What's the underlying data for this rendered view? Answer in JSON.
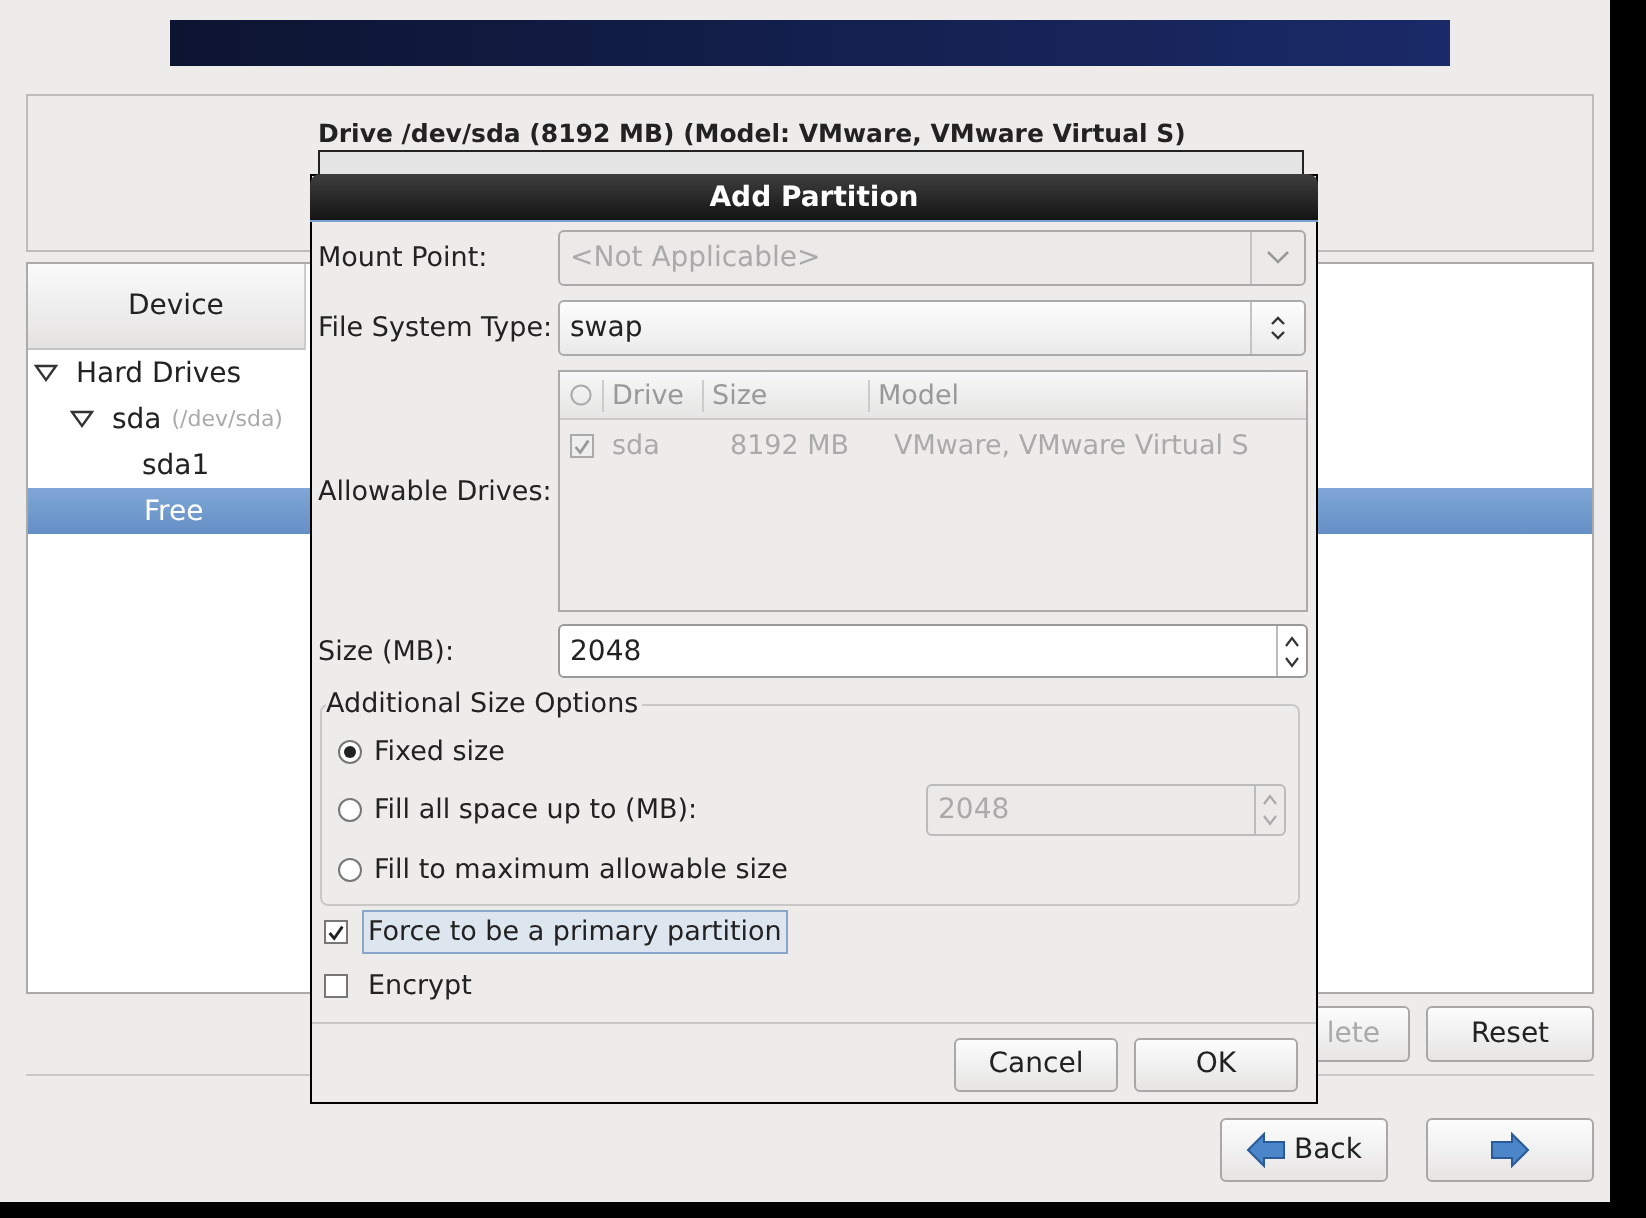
{
  "drive": {
    "title": "Drive /dev/sda (8192 MB) (Model: VMware, VMware Virtual S)"
  },
  "device_tree": {
    "column": "Device",
    "items": [
      {
        "label": "Hard Drives",
        "expanded": true,
        "selected": false,
        "children": [
          {
            "label": "sda",
            "note": "(/dev/sda)",
            "expanded": true,
            "selected": false,
            "children": [
              {
                "label": "sda1",
                "selected": false
              },
              {
                "label": "Free",
                "selected": true
              }
            ]
          }
        ]
      }
    ]
  },
  "buttons": [
    {
      "label": "lete",
      "disabled": true
    },
    {
      "label": "Reset",
      "disabled": false
    }
  ],
  "nav": {
    "back": "Back"
  },
  "dialog": {
    "title": "Add Partition",
    "mount_point": {
      "label": "Mount Point:",
      "value": "<Not Applicable>",
      "disabled": true
    },
    "fs_type": {
      "label": "File System Type:",
      "value": "swap"
    },
    "drives": {
      "label": "Allowable Drives:",
      "disabled": true,
      "columns": [
        "Drive",
        "Size",
        "Model"
      ],
      "rows": [
        {
          "checked": true,
          "drive": "sda",
          "size": "8192 MB",
          "model": "VMware, VMware Virtual S"
        }
      ]
    },
    "size": {
      "label": "Size (MB):",
      "value": "2048"
    },
    "size_options": {
      "title": "Additional Size Options",
      "options": [
        {
          "label": "Fixed size",
          "selected": true
        },
        {
          "label": "Fill all space up to (MB):",
          "selected": false,
          "value": "2048",
          "disabled": true
        },
        {
          "label": "Fill to maximum allowable size",
          "selected": false
        }
      ]
    },
    "checks": [
      {
        "label": "Force to be a primary partition",
        "checked": true,
        "focused": true
      },
      {
        "label": "Encrypt",
        "checked": false,
        "focused": false
      }
    ],
    "actions": [
      "Cancel",
      "OK"
    ]
  }
}
